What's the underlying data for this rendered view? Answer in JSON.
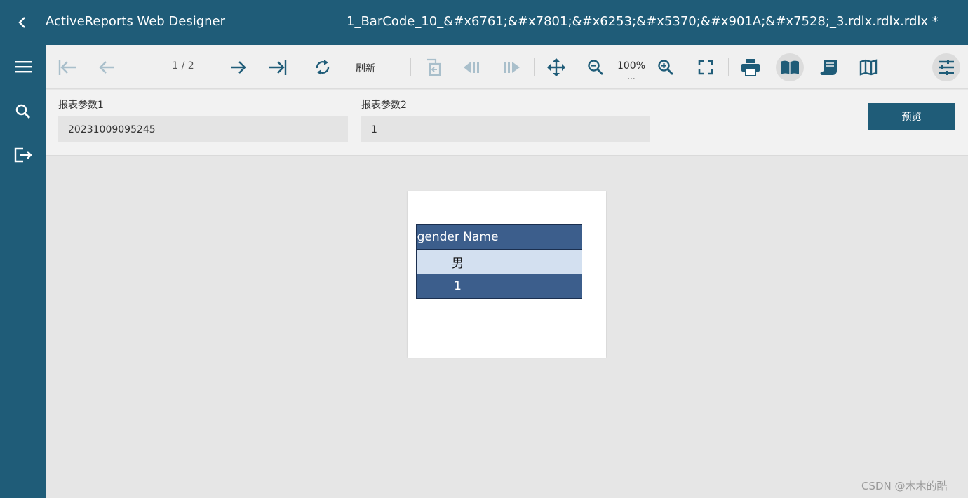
{
  "colors": {
    "brand": "#1f5c78",
    "table_header": "#3c5e8c",
    "table_light": "#d3e0f0"
  },
  "titlebar": {
    "back_icon": "chevron-left-icon",
    "app_title": "ActiveReports Web Designer",
    "doc_title": "1_BarCode_10_&#x6761;&#x7801;&#x6253;&#x5370;&#x901A;&#x7528;_3.rdlx.rdlx.rdlx *"
  },
  "sidebar": {
    "items": [
      {
        "icon": "menu-icon"
      },
      {
        "icon": "search-icon"
      },
      {
        "icon": "export-icon"
      }
    ]
  },
  "toolbar": {
    "page_indicator": "1 / 2",
    "refresh_label": "刷新",
    "zoom_label": "100%",
    "zoom_more": "..."
  },
  "params": {
    "param1": {
      "label": "报表参数1",
      "value": "20231009095245"
    },
    "param2": {
      "label": "报表参数2",
      "value": "1"
    },
    "preview_label": "预览"
  },
  "report": {
    "header": [
      "gender Name",
      ""
    ],
    "rows": [
      [
        "男",
        ""
      ],
      [
        "1",
        ""
      ]
    ]
  },
  "watermark": "CSDN @木木的酷"
}
